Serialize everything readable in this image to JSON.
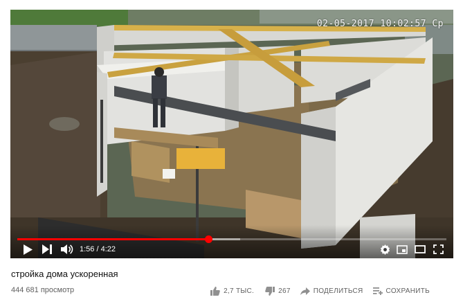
{
  "player": {
    "overlay_timestamp": "02-05-2017 10:02:57 Cp",
    "progress": {
      "played_fraction": 0.445,
      "buffered_fraction": 0.52
    },
    "time": {
      "current": "1:56",
      "separator": " / ",
      "duration": "4:22"
    },
    "icons": [
      "play-icon",
      "next-icon",
      "volume-icon",
      "settings-icon",
      "miniplayer-icon",
      "theater-icon",
      "fullscreen-icon"
    ],
    "accent_color": "#ff0000"
  },
  "video": {
    "title": "стройка дома ускоренная",
    "views": "444 681 просмотр"
  },
  "actions": {
    "like": {
      "label": "2,7 ТЫС.",
      "icon": "thumb-up-icon"
    },
    "dislike": {
      "label": "267",
      "icon": "thumb-down-icon"
    },
    "share": {
      "label": "ПОДЕЛИТЬСЯ",
      "icon": "share-icon"
    },
    "save": {
      "label": "СОХРАНИТЬ",
      "icon": "playlist-add-icon"
    }
  }
}
